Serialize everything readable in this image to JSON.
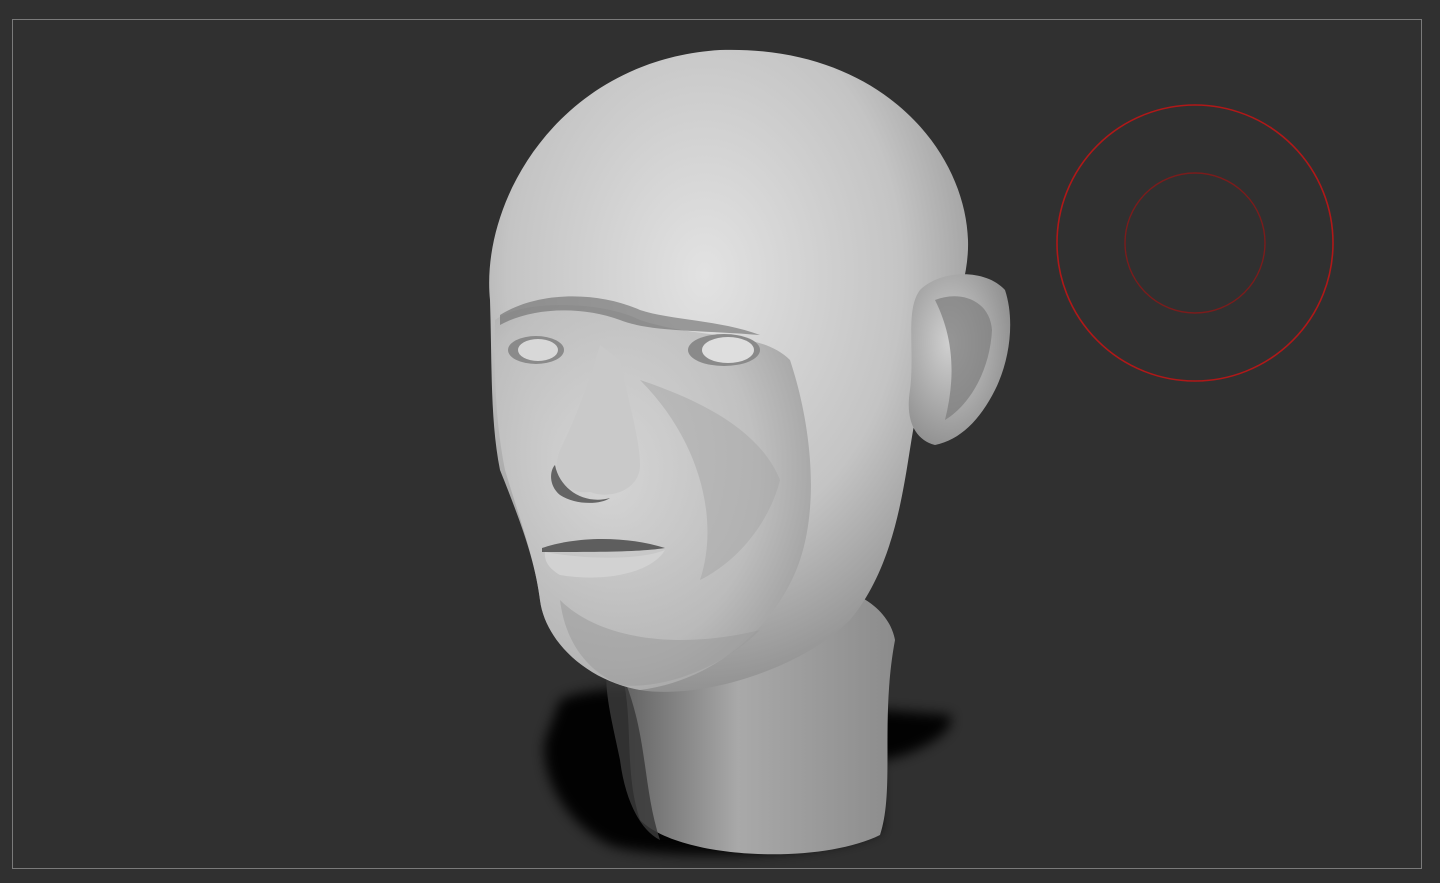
{
  "viewport": {
    "background_color": "#303030",
    "frame_color": "#7a7a7a"
  },
  "model": {
    "name_icon": "sculpted-head-model",
    "material_color": "#bdbdbd"
  },
  "brush_cursor": {
    "outer_ring_color": "#b01818",
    "inner_ring_color": "#7a1c1c"
  }
}
